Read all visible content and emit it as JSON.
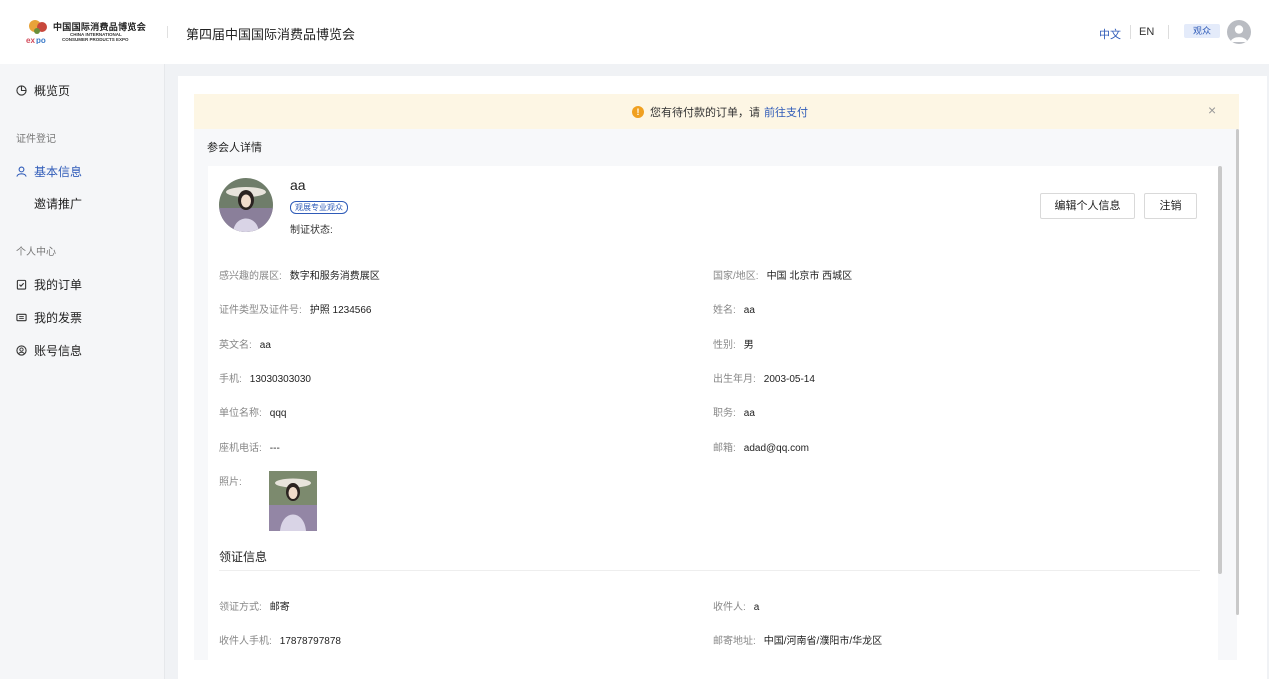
{
  "header": {
    "logo_cn": "中国国际消费品博览会",
    "logo_en_line1": "CHINA INTERNATIONAL",
    "logo_en_line2": "CONSUMER PRODUCTS EXPO",
    "site_title": "第四届中国国际消费品博览会",
    "lang_zh": "中文",
    "lang_en": "EN",
    "role": "观众"
  },
  "sidebar": {
    "overview": "概览页",
    "group_register": "证件登记",
    "basic_info": "基本信息",
    "invite": "邀请推广",
    "group_personal": "个人中心",
    "my_orders": "我的订单",
    "my_invoices": "我的发票",
    "account_info": "账号信息"
  },
  "notice": {
    "text": "您有待付款的订单，请",
    "link": "前往支付"
  },
  "section_title": "参会人详情",
  "profile": {
    "name": "aa",
    "tag": "观展专业观众",
    "cert_status_label": "制证状态:",
    "edit_button": "编辑个人信息",
    "cancel_button": "注销"
  },
  "fields": {
    "interest_label": "感兴趣的展区:",
    "interest_value": "数字和服务消费展区",
    "country_label": "国家/地区:",
    "country_value": "中国 北京市 西城区",
    "id_label": "证件类型及证件号:",
    "id_value": "护照 1234566",
    "name_label": "姓名:",
    "name_value": "aa",
    "en_name_label": "英文名:",
    "en_name_value": "aa",
    "gender_label": "性别:",
    "gender_value": "男",
    "phone_label": "手机:",
    "phone_value": "13030303030",
    "birth_label": "出生年月:",
    "birth_value": "2003-05-14",
    "company_label": "单位名称:",
    "company_value": "qqq",
    "position_label": "职务:",
    "position_value": "aa",
    "landline_label": "座机电话:",
    "landline_value": "---",
    "email_label": "邮箱:",
    "email_value": "adad@qq.com",
    "photo_label": "照片:"
  },
  "pickup": {
    "title": "领证信息",
    "method_label": "领证方式:",
    "method_value": "邮寄",
    "recipient_label": "收件人:",
    "recipient_value": "a",
    "recipient_phone_label": "收件人手机:",
    "recipient_phone_value": "17878797878",
    "address_label": "邮寄地址:",
    "address_value": "中国/河南省/濮阳市/华龙区"
  }
}
